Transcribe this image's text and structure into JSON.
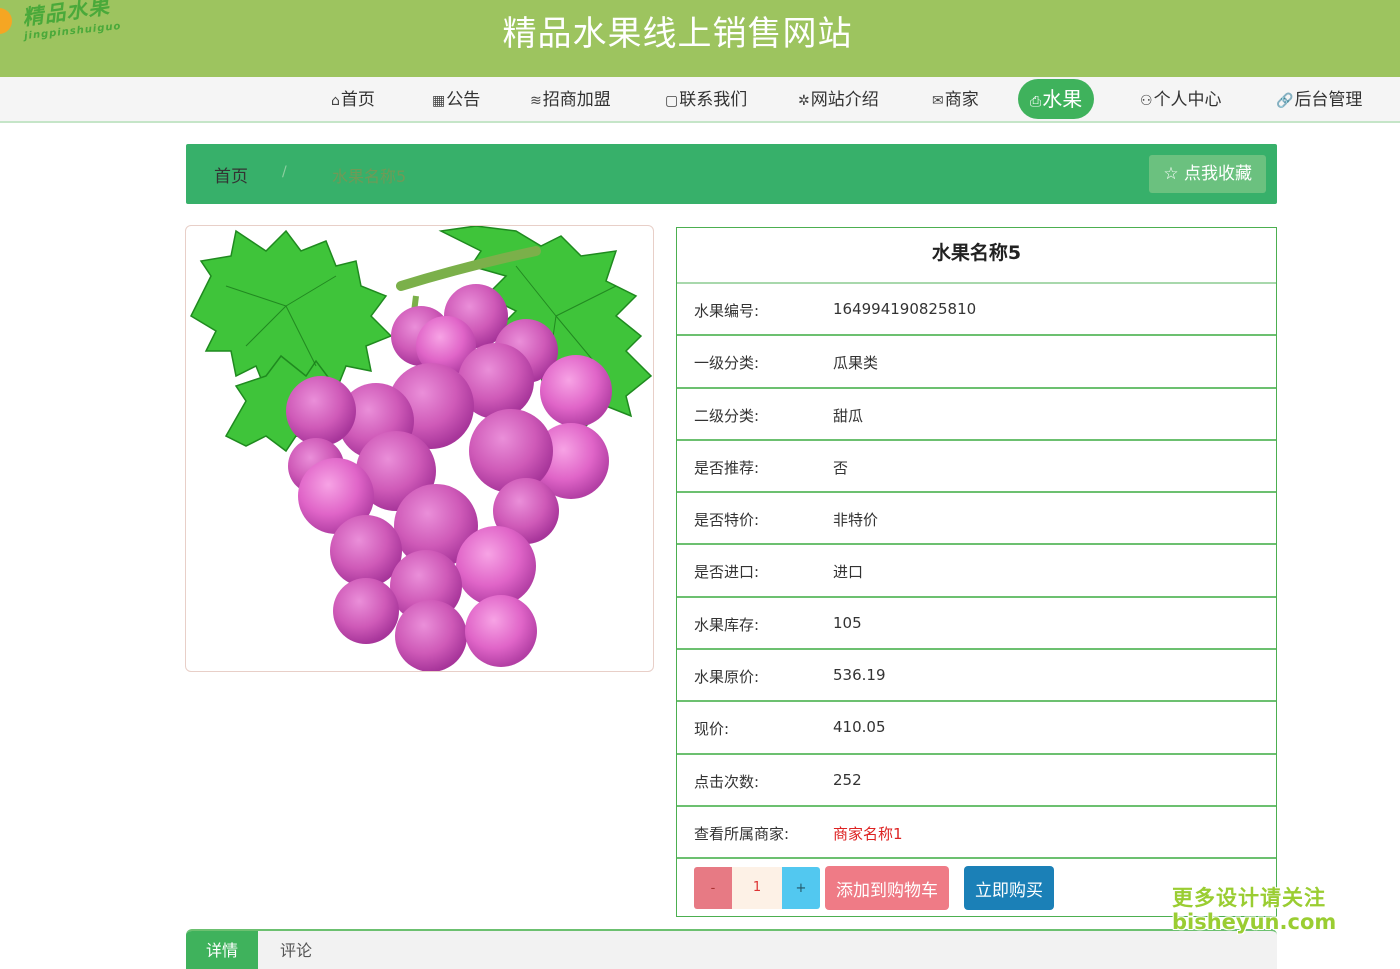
{
  "header": {
    "logo_cn": "精品水果",
    "logo_en": "jingpinshuiguo",
    "title": "精品水果线上销售网站"
  },
  "nav": {
    "items": [
      {
        "icon": "⌂",
        "label": "首页"
      },
      {
        "icon": "▦",
        "label": "公告"
      },
      {
        "icon": "≋",
        "label": "招商加盟"
      },
      {
        "icon": "▢",
        "label": "联系我们"
      },
      {
        "icon": "✲",
        "label": "网站介绍"
      },
      {
        "icon": "✉",
        "label": "商家"
      },
      {
        "icon": "⎙",
        "label": "水果"
      },
      {
        "icon": "⚇",
        "label": "个人中心"
      },
      {
        "icon": "🔗",
        "label": "后台管理"
      }
    ]
  },
  "breadcrumb": {
    "home": "首页",
    "separator": "/",
    "current": "水果名称5",
    "favorite_label": "☆ 点我收藏"
  },
  "product": {
    "name": "水果名称5",
    "fields": [
      {
        "label": "水果编号:",
        "value": "164994190825810"
      },
      {
        "label": "一级分类:",
        "value": "瓜果类"
      },
      {
        "label": "二级分类:",
        "value": "甜瓜"
      },
      {
        "label": "是否推荐:",
        "value": "否"
      },
      {
        "label": "是否特价:",
        "value": "非特价"
      },
      {
        "label": "是否进口:",
        "value": "进口"
      },
      {
        "label": "水果库存:",
        "value": "105"
      },
      {
        "label": "水果原价:",
        "value": "536.19"
      },
      {
        "label": "现价:",
        "value": "410.05"
      },
      {
        "label": "点击次数:",
        "value": "252"
      },
      {
        "label": "查看所属商家:",
        "value": "商家名称1"
      }
    ],
    "quantity": "1",
    "minus": "-",
    "plus": "+",
    "add_to_cart": "添加到购物车",
    "buy_now": "立即购买"
  },
  "tabs": [
    {
      "label": "详情"
    },
    {
      "label": "评论"
    }
  ],
  "watermark": {
    "line1": "更多设计请关注",
    "line2": "bisheyun.com"
  },
  "colors": {
    "header_bg": "#9dc45f",
    "accent_green": "#3fb25c",
    "crumb_bar": "#37b06a",
    "cart_btn": "#ef7b86",
    "buy_btn": "#1b80b7",
    "merchant_link": "#dd2222"
  }
}
